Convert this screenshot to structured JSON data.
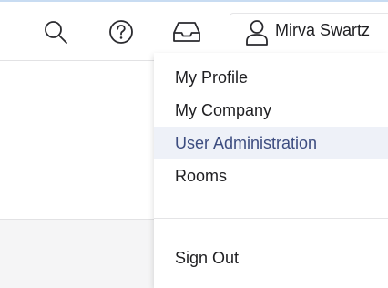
{
  "header": {
    "search_icon": "search-icon",
    "help_icon": "help-icon",
    "inbox_icon": "inbox-icon",
    "user": {
      "icon": "user-icon",
      "name": "Mirva Swartz"
    }
  },
  "user_menu": {
    "items": [
      {
        "label": "My Profile",
        "active": false
      },
      {
        "label": "My Company",
        "active": false
      },
      {
        "label": "User Administration",
        "active": true
      },
      {
        "label": "Rooms",
        "active": false
      }
    ],
    "sign_out_label": "Sign Out"
  },
  "colors": {
    "active_text": "#3d4d80",
    "active_bg": "#eef1f8",
    "icon": "#2a2a2e"
  }
}
